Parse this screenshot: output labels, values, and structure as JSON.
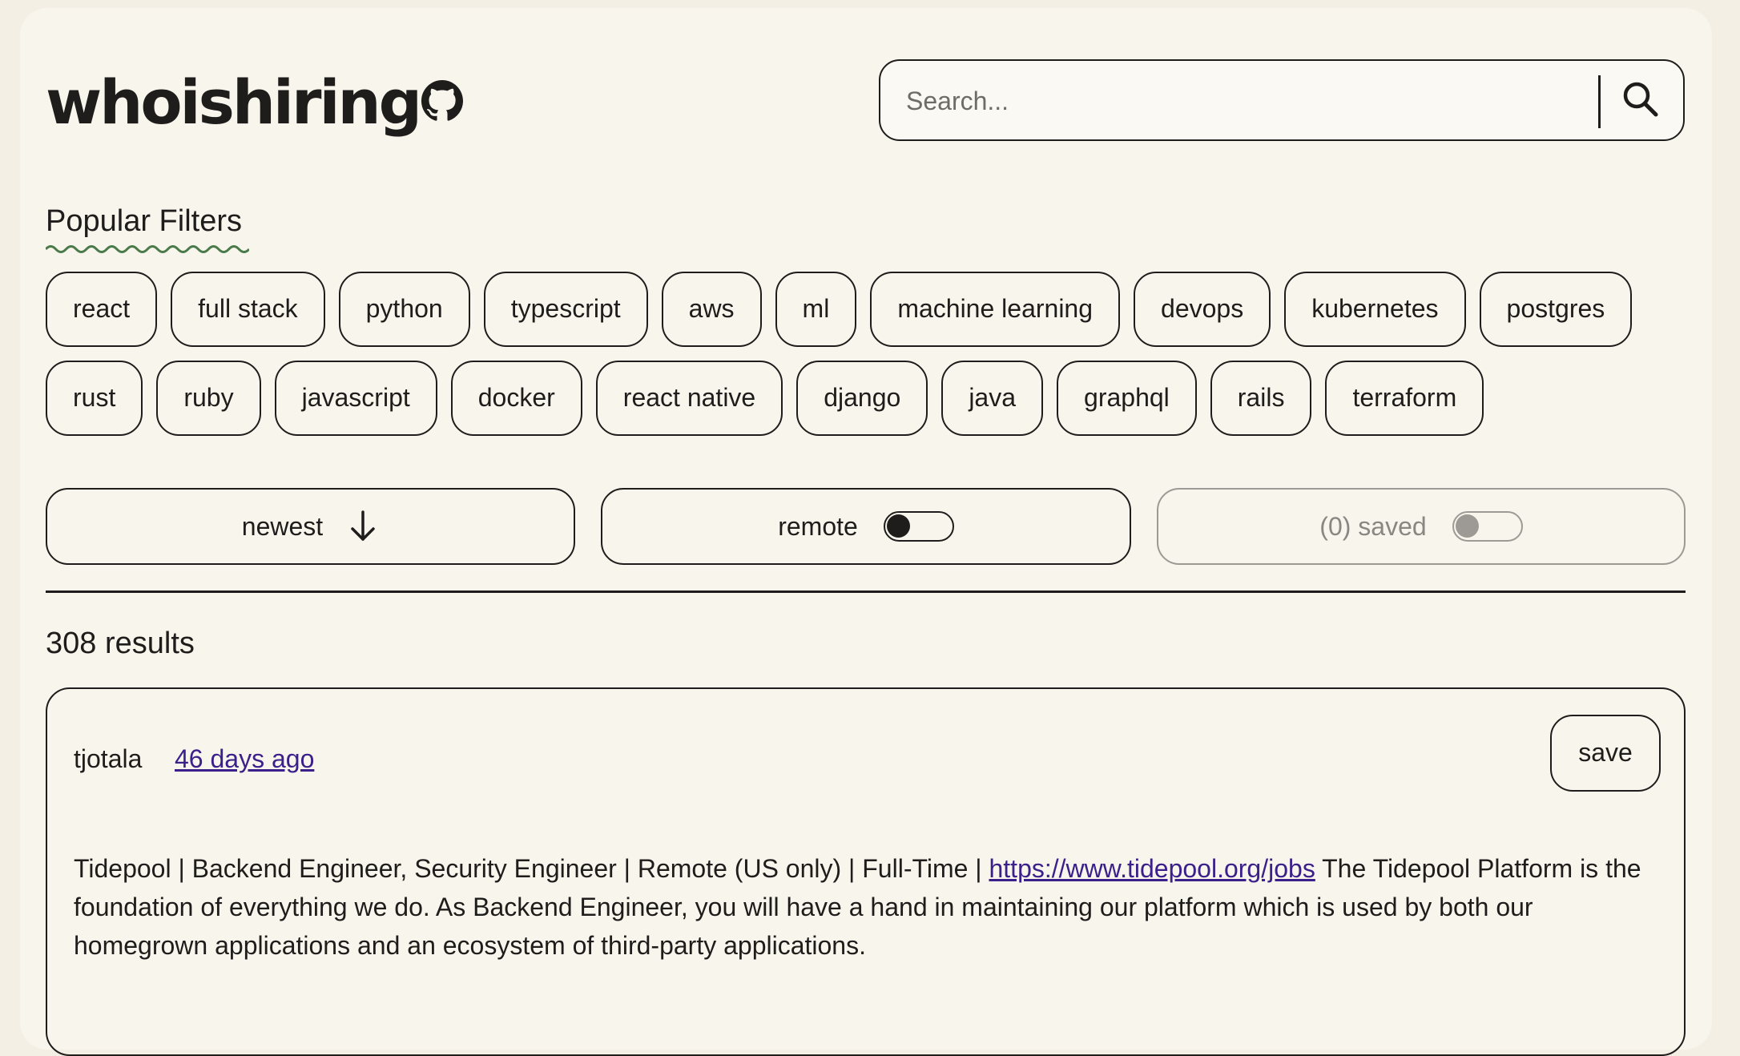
{
  "app": {
    "logo_text": "whoishiring"
  },
  "search": {
    "placeholder": "Search..."
  },
  "filters": {
    "title": "Popular Filters",
    "row1": [
      "react",
      "full stack",
      "python",
      "typescript",
      "aws",
      "ml",
      "machine learning",
      "devops",
      "kubernetes",
      "postgres"
    ],
    "row2": [
      "rust",
      "ruby",
      "javascript",
      "docker",
      "react native",
      "django",
      "java",
      "graphql",
      "rails",
      "terraform"
    ]
  },
  "controls": {
    "sort_label": "newest",
    "remote_label": "remote",
    "remote_on": false,
    "saved_label": "(0) saved",
    "saved_on": false
  },
  "results": {
    "count_text": "308 results"
  },
  "post": {
    "author": "tjotala",
    "age": "46 days ago",
    "save_label": "save",
    "text_before": "Tidepool | Backend Engineer, Security Engineer | Remote (US only) | Full-Time | ",
    "link_text": "https://www.tidepool.org/jobs",
    "text_after": " The Tidepool Platform is the foundation of everything we do. As Backend Engineer, you will have a hand in maintaining our platform which is used by both our homegrown applications and an ecosystem of third-party applications."
  },
  "colors": {
    "background": "#f8f5ed",
    "ink": "#1f1d1b",
    "link": "#3b1f8a",
    "squiggle": "#4a7a4a",
    "muted": "#9d9994"
  }
}
